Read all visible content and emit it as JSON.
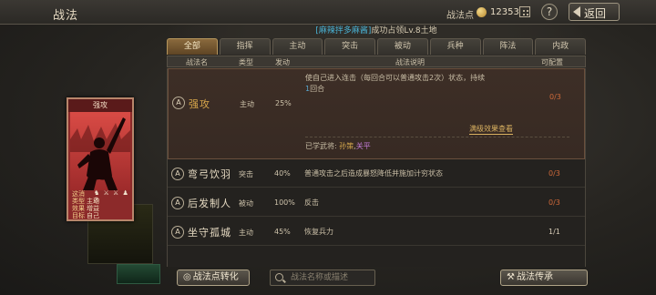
{
  "header": {
    "title": "战法",
    "points_label": "战法点",
    "points_value": "12353",
    "help_label": "?",
    "back_label": "返回"
  },
  "subtitle": {
    "prefix": "[麻辣拌多麻酱]",
    "suffix": "成功占领Lv.8土地"
  },
  "tabs": [
    "全部",
    "指挥",
    "主动",
    "突击",
    "被动",
    "兵种",
    "阵法",
    "内政"
  ],
  "active_tab": 0,
  "columns": [
    "战法名",
    "类型",
    "发动",
    "战法说明",
    "可配置"
  ],
  "skills": [
    {
      "grade": "A",
      "name": "强攻",
      "type": "主动",
      "rate": "25%",
      "desc_line1": "使自己进入连击（每回合可以普通攻击2次）状态，持续",
      "desc_line2_num": "1",
      "desc_line2_rest": "回合",
      "count": "0/3",
      "full_effect_link": "满级效果查看",
      "learned_label": "已学武将:",
      "learned_hero1": "孙策",
      "learned_sep": ",",
      "learned_hero2": "关平"
    },
    {
      "grade": "A",
      "name": "弯弓饮羽",
      "type": "突击",
      "rate": "40%",
      "desc": "普通攻击之后造成暴怒降低并施加计穷状态",
      "count": "0/3"
    },
    {
      "grade": "A",
      "name": "后发制人",
      "type": "被动",
      "rate": "100%",
      "desc": "反击",
      "count": "0/3"
    },
    {
      "grade": "A",
      "name": "坐守孤城",
      "type": "主动",
      "rate": "45%",
      "desc": "恢复兵力",
      "count": "1/1"
    }
  ],
  "card": {
    "title": "强攻",
    "icons": "♞ ⚔ ⚔ ♟ ✇",
    "info": [
      {
        "k": "这消",
        "v": ""
      },
      {
        "k": "类型",
        "v": "主动"
      },
      {
        "k": "效果",
        "v": "增益"
      },
      {
        "k": "目标",
        "v": "自己"
      }
    ]
  },
  "bottom": {
    "convert_label": "战法点转化",
    "search_placeholder": "战法名称或描述",
    "pass_label": "战法传承"
  },
  "colors": {
    "accent_gold": "#d9a84b",
    "count_red": "#d06a3a",
    "card_red": "#8c2a2a",
    "highlight_blue": "#4ab3d6"
  }
}
